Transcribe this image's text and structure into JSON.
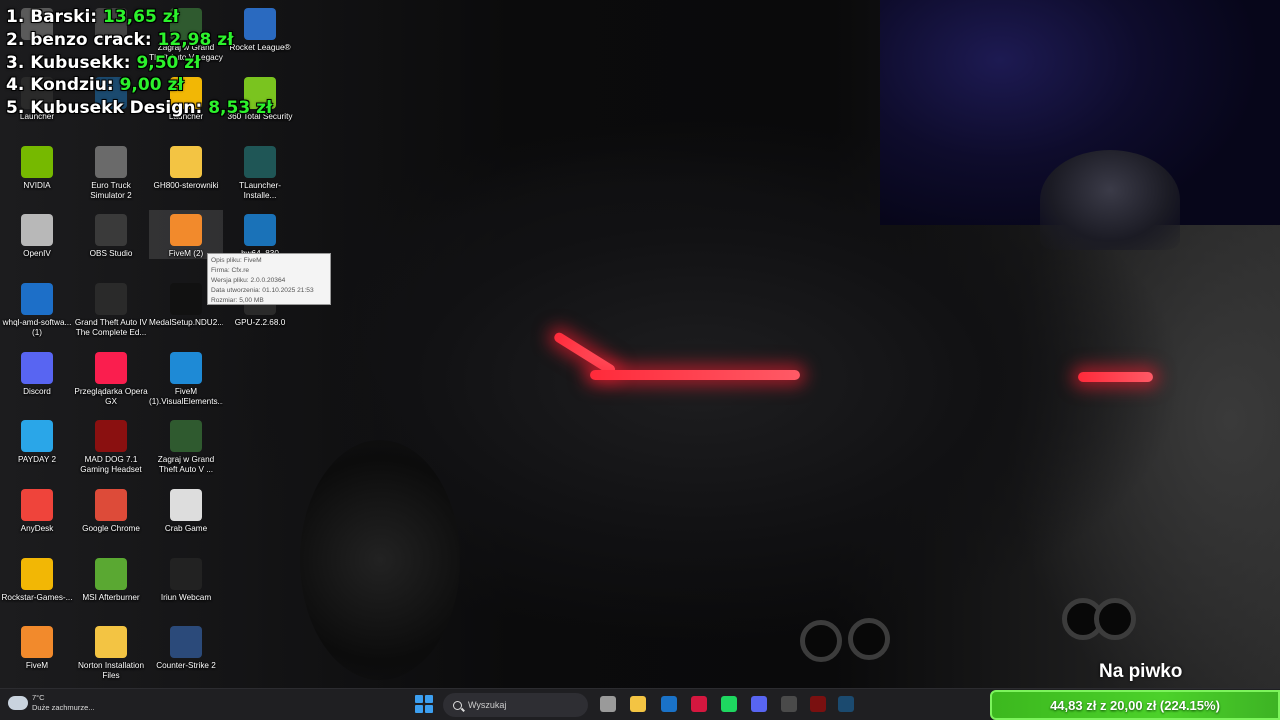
{
  "leaderboard": [
    {
      "name": "1. Barski:",
      "amount": "13,65 zł"
    },
    {
      "name": "2. benzo crack:",
      "amount": "12,98 zł"
    },
    {
      "name": "3. Kubusekk:",
      "amount": "9,50 zł"
    },
    {
      "name": "4. Kondziu:",
      "amount": "9,00 zł"
    },
    {
      "name": "5. Kubusekk Design:",
      "amount": "8,53 zł"
    }
  ],
  "desktop_icons": {
    "col1": [
      {
        "label": "",
        "icon": "app-icon",
        "color": "#5a5a5a"
      },
      {
        "label": "Launcher",
        "icon": "epic-games-icon",
        "color": "#2a2a2a"
      },
      {
        "label": "NVIDIA",
        "icon": "nvidia-icon",
        "color": "#76b900"
      },
      {
        "label": "OpenIV",
        "icon": "openiv-icon",
        "color": "#b8b8b8"
      },
      {
        "label": "whql-amd-softwa... (1)",
        "icon": "amd-installer-icon",
        "color": "#1d6fc8"
      },
      {
        "label": "Discord",
        "icon": "discord-icon",
        "color": "#5865f2"
      },
      {
        "label": "PAYDAY 2",
        "icon": "payday-icon",
        "color": "#2aa6e8"
      },
      {
        "label": "AnyDesk",
        "icon": "anydesk-icon",
        "color": "#ef443b"
      },
      {
        "label": "Rockstar-Games-...",
        "icon": "rockstar-icon",
        "color": "#f2b705"
      },
      {
        "label": "FiveM",
        "icon": "fivem-icon",
        "color": "#f28a2c"
      }
    ],
    "col2": [
      {
        "label": "",
        "icon": "app-icon",
        "color": "#444444"
      },
      {
        "label": "",
        "icon": "steam-icon",
        "color": "#1b4a6f"
      },
      {
        "label": "Euro Truck Simulator 2",
        "icon": "euro-truck-icon",
        "color": "#6a6a6a"
      },
      {
        "label": "OBS Studio",
        "icon": "obs-icon",
        "color": "#3a3a3a"
      },
      {
        "label": "Grand Theft Auto IV The Complete Ed...",
        "icon": "gta-iv-icon",
        "color": "#2a2a2a"
      },
      {
        "label": "Przeglądarka Opera GX",
        "icon": "opera-gx-icon",
        "color": "#fa1e4e"
      },
      {
        "label": "MAD DOG 7.1 Gaming Headset",
        "icon": "headset-icon",
        "color": "#8a1010"
      },
      {
        "label": "Google Chrome",
        "icon": "chrome-icon",
        "color": "#dd4b39"
      },
      {
        "label": "MSI Afterburner",
        "icon": "msi-afterburner-icon",
        "color": "#5aa832"
      },
      {
        "label": "Norton Installation Files",
        "icon": "folder-icon",
        "color": "#f3c443"
      }
    ],
    "col3": [
      {
        "label": "Zagraj w Grand Theft Auto V Legacy",
        "icon": "gta-v-icon",
        "color": "#2f5a2f"
      },
      {
        "label": "Launcher",
        "icon": "rockstar-launcher-icon",
        "color": "#f2b705"
      },
      {
        "label": "GH800-sterowniki",
        "icon": "folder-icon",
        "color": "#f3c443"
      },
      {
        "label": "FiveM (2)",
        "icon": "fivem-icon",
        "color": "#f28a2c"
      },
      {
        "label": "MedalSetup.NDU2...",
        "icon": "medal-icon",
        "color": "#111111"
      },
      {
        "label": "FiveM (1).VisualElements...",
        "icon": "edge-icon",
        "color": "#1e8ad6"
      },
      {
        "label": "Zagraj w Grand Theft Auto V ...",
        "icon": "gta-v-icon",
        "color": "#2f5a2f"
      },
      {
        "label": "Crab Game",
        "icon": "crab-game-icon",
        "color": "#dddddd"
      },
      {
        "label": "Iriun Webcam",
        "icon": "webcam-icon",
        "color": "#222222"
      },
      {
        "label": "Counter-Strike 2",
        "icon": "cs2-icon",
        "color": "#2b4a7a"
      }
    ],
    "col4": [
      {
        "label": "Rocket League®",
        "icon": "rocket-league-icon",
        "color": "#2a6ac0"
      },
      {
        "label": "360 Total Security",
        "icon": "security-icon",
        "color": "#7ac41f"
      },
      {
        "label": "TLauncher-Installe...",
        "icon": "tlauncher-icon",
        "color": "#1f5656"
      },
      {
        "label": "hw64_830",
        "icon": "hwinfo-icon",
        "color": "#1a72b8"
      },
      {
        "label": "GPU-Z.2.68.0",
        "icon": "gpuz-icon",
        "color": "#2a2a2a"
      }
    ]
  },
  "tooltip": {
    "line1": "Opis pliku: FiveM",
    "line2": "Firma: Cfx.re",
    "line3": "Wersja pliku: 2.0.0.20364",
    "line4": "Data utworzenia: 01.10.2025 21:53",
    "line5": "Rozmiar: 5,00 MB"
  },
  "donation": {
    "title": "Na piwko",
    "progress_text": "44,83 zł z 20,00 zł (224.15%)",
    "percent": 224.15
  },
  "taskbar": {
    "weather_temp": "7°C",
    "weather_desc": "Duże zachmurze...",
    "search_placeholder": "Wyszukaj",
    "apps": [
      {
        "icon": "task-view-icon",
        "color": "#9a9a9a"
      },
      {
        "icon": "file-explorer-icon",
        "color": "#f3c443"
      },
      {
        "icon": "outlook-icon",
        "color": "#1a72c8"
      },
      {
        "icon": "opera-gx-icon",
        "color": "#d4173f"
      },
      {
        "icon": "spotify-icon",
        "color": "#1ed760"
      },
      {
        "icon": "discord-icon",
        "color": "#5865f2"
      },
      {
        "icon": "obs-icon",
        "color": "#4a4a4a"
      },
      {
        "icon": "headset-icon",
        "color": "#7a1010"
      },
      {
        "icon": "steam-icon",
        "color": "#1b4a6f"
      }
    ]
  }
}
